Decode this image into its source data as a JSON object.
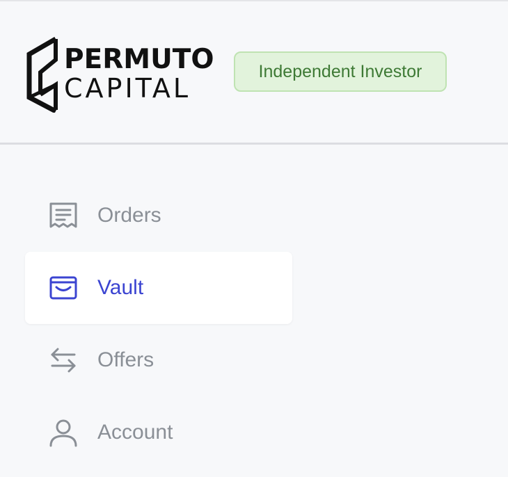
{
  "brand": {
    "line1": "PERMUTO",
    "line2": "CAPITAL"
  },
  "badge": {
    "label": "Independent Investor",
    "bg_color": "#e2f3dc",
    "border_color": "#bfe3b2",
    "text_color": "#3e7a35"
  },
  "nav": {
    "active_color": "#3b44d1",
    "inactive_color": "#8a8f96",
    "items": [
      {
        "label": "Orders",
        "icon": "receipt-icon",
        "active": false
      },
      {
        "label": "Vault",
        "icon": "vault-icon",
        "active": true
      },
      {
        "label": "Offers",
        "icon": "arrows-exchange-icon",
        "active": false
      },
      {
        "label": "Account",
        "icon": "user-icon",
        "active": false
      }
    ]
  }
}
